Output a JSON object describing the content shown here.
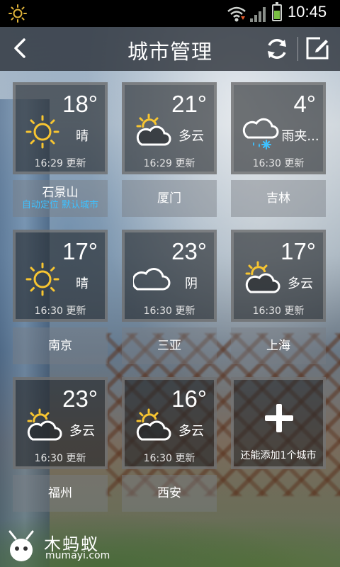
{
  "status_bar": {
    "time": "10:45"
  },
  "header": {
    "title": "城市管理"
  },
  "cities": [
    {
      "temp": "18°",
      "condition": "晴",
      "icon": "sun-icon",
      "updated": "16:29  更新",
      "name": "石景山",
      "tag_auto": "自动定位",
      "tag_default": "默认城市"
    },
    {
      "temp": "21°",
      "condition": "多云",
      "icon": "partly-cloudy-icon",
      "updated": "16:29  更新",
      "name": "厦门"
    },
    {
      "temp": "4°",
      "condition": "雨夹...",
      "icon": "sleet-icon",
      "updated": "16:30  更新",
      "name": "吉林"
    },
    {
      "temp": "17°",
      "condition": "晴",
      "icon": "sun-icon",
      "updated": "16:30  更新",
      "name": "南京"
    },
    {
      "temp": "23°",
      "condition": "阴",
      "icon": "cloud-icon",
      "updated": "16:30  更新",
      "name": "三亚"
    },
    {
      "temp": "17°",
      "condition": "多云",
      "icon": "partly-cloudy-icon",
      "updated": "16:30  更新",
      "name": "上海"
    },
    {
      "temp": "23°",
      "condition": "多云",
      "icon": "partly-cloudy-icon",
      "updated": "16:30  更新",
      "name": "福州"
    },
    {
      "temp": "16°",
      "condition": "多云",
      "icon": "partly-cloudy-icon",
      "updated": "16:30  更新",
      "name": "西安"
    }
  ],
  "add_city": {
    "label": "还能添加1个城市"
  },
  "watermark": {
    "brand": "木蚂蚁",
    "url": "mumayi.com"
  },
  "colors": {
    "accent_tag": "#3ec1ff",
    "sun": "#f7c531",
    "battery": "#7ac043"
  }
}
